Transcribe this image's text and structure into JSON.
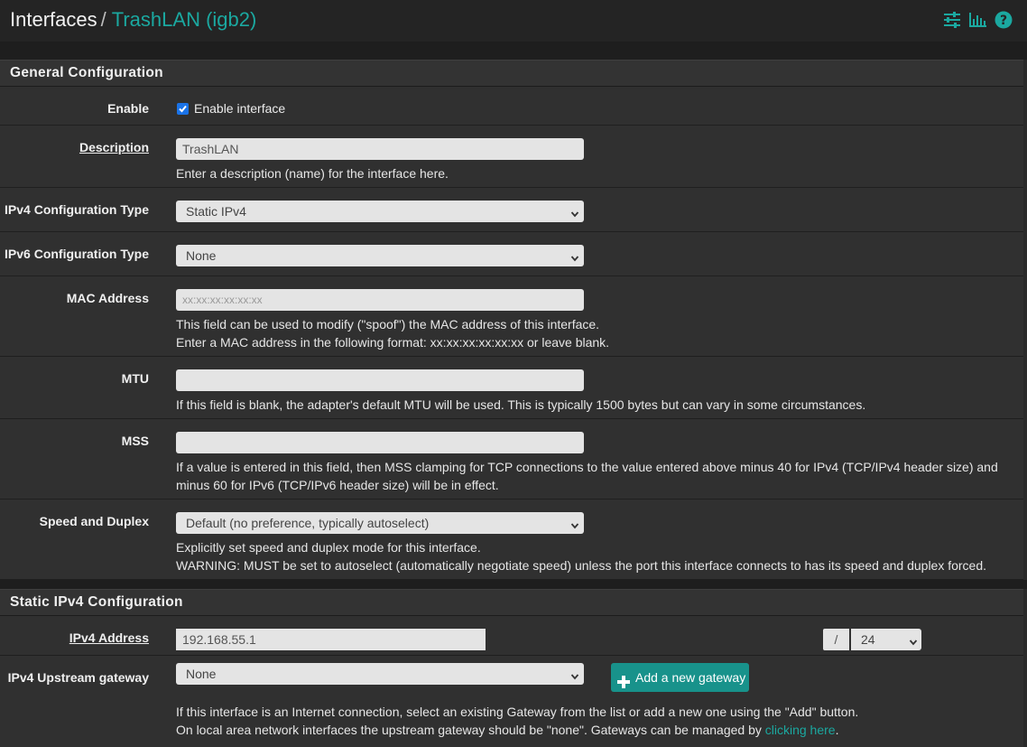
{
  "breadcrumb": {
    "root": "Interfaces",
    "separator": "/",
    "current": "TrashLAN (igb2)"
  },
  "top_icons": [
    "sliders-icon",
    "bar-chart-icon",
    "help-icon"
  ],
  "colors": {
    "accent": "#1ba8a0",
    "checkbox": "#1a73e8",
    "button": "#18928b"
  },
  "general": {
    "title": "General Configuration",
    "enable": {
      "label": "Enable",
      "checkbox_label": "Enable interface",
      "checked": true
    },
    "description": {
      "label": "Description",
      "value": "TrashLAN",
      "help": "Enter a description (name) for the interface here."
    },
    "ipv4_type": {
      "label": "IPv4 Configuration Type",
      "value": "Static IPv4"
    },
    "ipv6_type": {
      "label": "IPv6 Configuration Type",
      "value": "None"
    },
    "mac": {
      "label": "MAC Address",
      "placeholder": "xx:xx:xx:xx:xx:xx",
      "help1": "This field can be used to modify (\"spoof\") the MAC address of this interface.",
      "help2": "Enter a MAC address in the following format: xx:xx:xx:xx:xx:xx or leave blank."
    },
    "mtu": {
      "label": "MTU",
      "value": "",
      "help": "If this field is blank, the adapter's default MTU will be used. This is typically 1500 bytes but can vary in some circumstances."
    },
    "mss": {
      "label": "MSS",
      "value": "",
      "help1": "If a value is entered in this field, then MSS clamping for TCP connections to the value entered above minus 40 for IPv4 (TCP/IPv4 header size) and",
      "help2": "minus 60 for IPv6 (TCP/IPv6 header size) will be in effect."
    },
    "speed": {
      "label": "Speed and Duplex",
      "value": "Default (no preference, typically autoselect)",
      "help1": "Explicitly set speed and duplex mode for this interface.",
      "help2": "WARNING: MUST be set to autoselect (automatically negotiate speed) unless the port this interface connects to has its speed and duplex forced."
    }
  },
  "static_ipv4": {
    "title": "Static IPv4 Configuration",
    "address": {
      "label": "IPv4 Address",
      "value": "192.168.55.1",
      "cidr_separator": "/",
      "cidr": "24"
    },
    "gateway": {
      "label": "IPv4 Upstream gateway",
      "value": "None",
      "add_button": "Add a new gateway",
      "help1": "If this interface is an Internet connection, select an existing Gateway from the list or add a new one using the \"Add\" button.",
      "help2_prefix": "On local area network interfaces the upstream gateway should be \"none\". Gateways can be managed by ",
      "help2_link": "clicking here",
      "help2_suffix": "."
    }
  }
}
